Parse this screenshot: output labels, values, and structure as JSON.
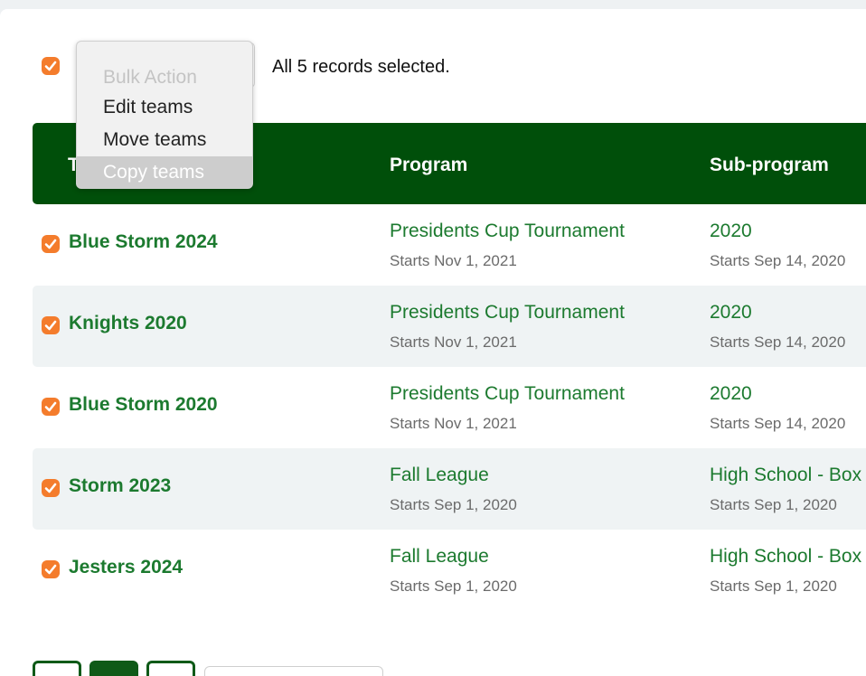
{
  "toolbar": {
    "bulk_action_placeholder": "Bulk Action",
    "selected_message": "All 5 records selected."
  },
  "dropdown": {
    "items": [
      {
        "label": "Bulk Action",
        "state": "disabled"
      },
      {
        "label": "Edit teams",
        "state": "normal"
      },
      {
        "label": "Move teams",
        "state": "normal"
      },
      {
        "label": "Copy teams",
        "state": "highlighted"
      }
    ]
  },
  "table": {
    "headers": [
      "T",
      "Program",
      "Sub-program"
    ],
    "rows": [
      {
        "team": "Blue Storm 2024",
        "program": "Presidents Cup Tournament",
        "program_start": "Starts Nov 1, 2021",
        "subprogram": "2020",
        "subprogram_start": "Starts Sep 14, 2020",
        "checked": true
      },
      {
        "team": "Knights 2020",
        "program": "Presidents Cup Tournament",
        "program_start": "Starts Nov 1, 2021",
        "subprogram": "2020",
        "subprogram_start": "Starts Sep 14, 2020",
        "checked": true
      },
      {
        "team": "Blue Storm 2020",
        "program": "Presidents Cup Tournament",
        "program_start": "Starts Nov 1, 2021",
        "subprogram": "2020",
        "subprogram_start": "Starts Sep 14, 2020",
        "checked": true
      },
      {
        "team": "Storm 2023",
        "program": "Fall League",
        "program_start": "Starts Sep 1, 2020",
        "subprogram": "High School - Box",
        "subprogram_start": "Starts Sep 1, 2020",
        "checked": true
      },
      {
        "team": "Jesters 2024",
        "program": "Fall League",
        "program_start": "Starts Sep 1, 2020",
        "subprogram": "High School - Box",
        "subprogram_start": "Starts Sep 1, 2020",
        "checked": true
      }
    ]
  },
  "colors": {
    "header_bg": "#004f0a",
    "link_green": "#1c7a2f",
    "checkbox_orange": "#f47c2c",
    "row_alt_bg": "#eff3f4"
  },
  "icons": {
    "checkbox": "checkmark-icon",
    "pager_prev": "chevron-left-icon",
    "pager_next": "chevron-right-icon",
    "select_caret": "up-down-caret-icon"
  }
}
